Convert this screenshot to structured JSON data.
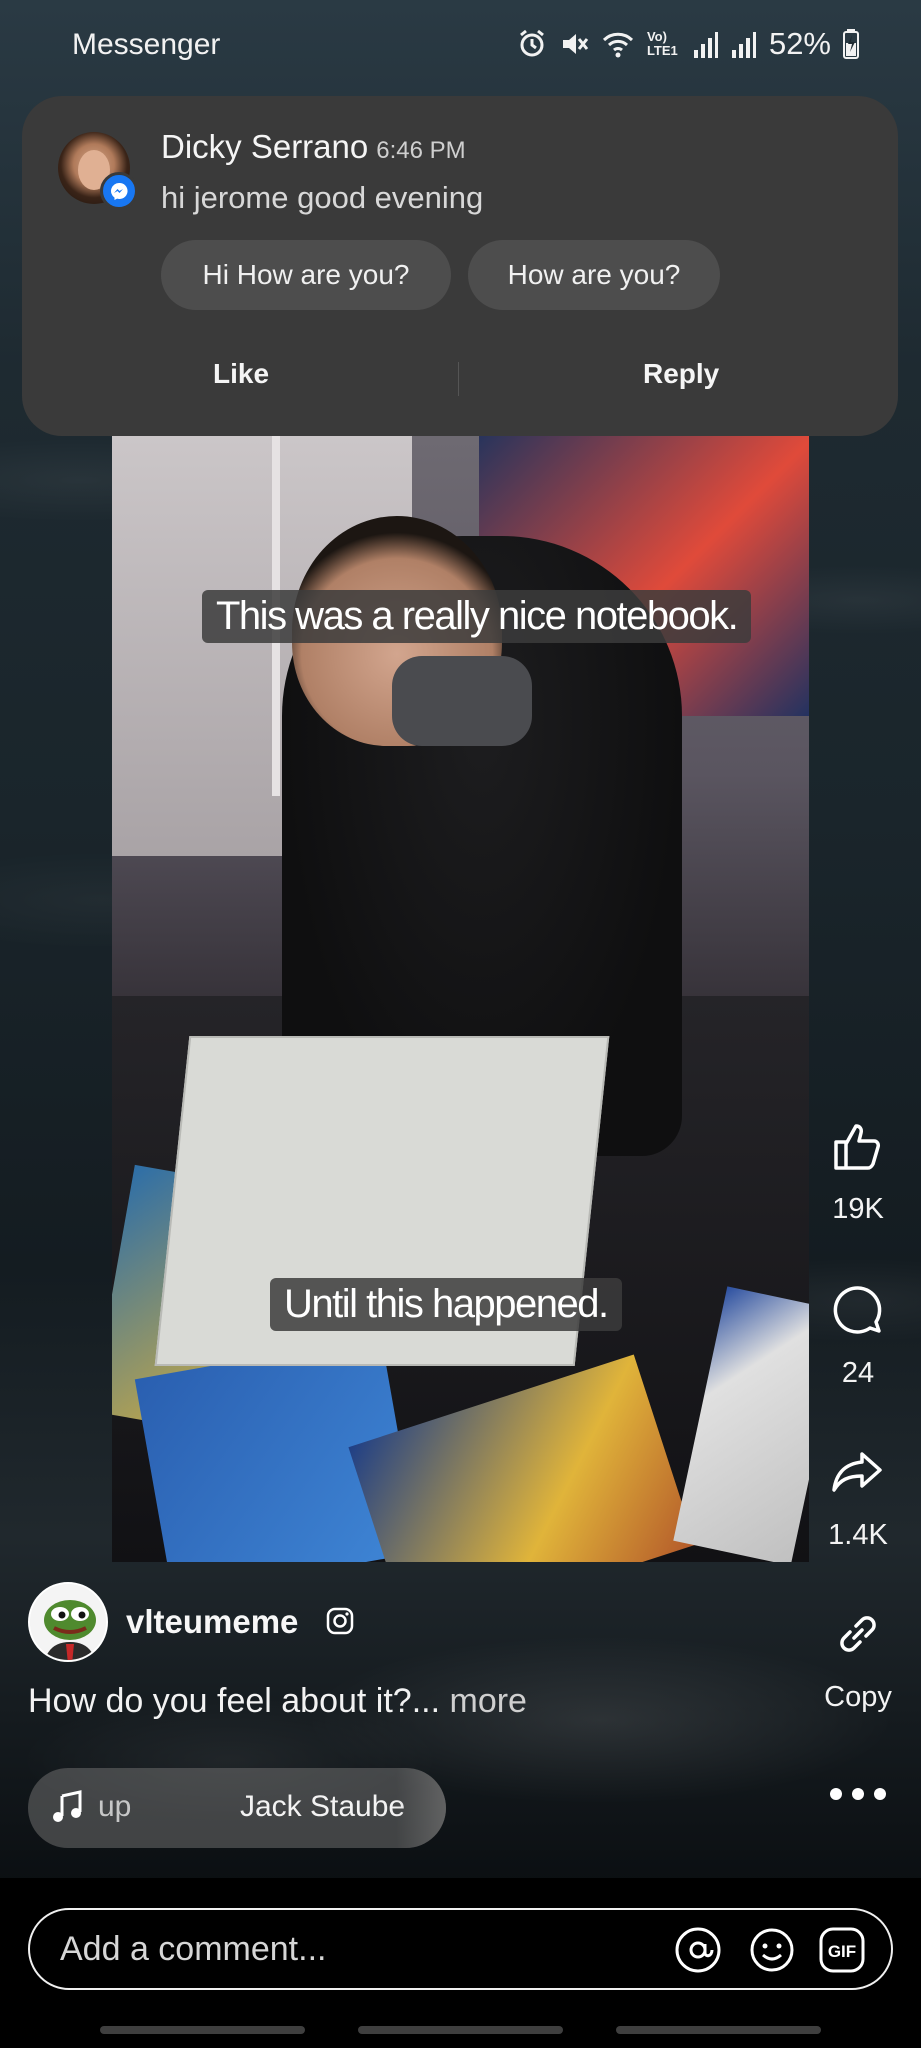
{
  "status_bar": {
    "app_name": "Messenger",
    "network_label": "Vo) LTE1",
    "battery": "52%",
    "icons": [
      "alarm-icon",
      "mute-icon",
      "wifi-icon",
      "signal-icon",
      "signal-icon",
      "battery-icon"
    ]
  },
  "notification": {
    "sender": "Dicky Serrano",
    "time": "6:46 PM",
    "message": "hi jerome good evening",
    "quick_replies": [
      "Hi How are you?",
      "How are you?"
    ],
    "actions": {
      "like": "Like",
      "reply": "Reply"
    },
    "badge_icon": "messenger-icon"
  },
  "video": {
    "captions": [
      "This was a really nice notebook.",
      "Until this happened."
    ]
  },
  "rail": {
    "like_count": "19K",
    "comment_count": "24",
    "share_count": "1.4K",
    "copy_label": "Copy",
    "icons": [
      "thumbs-up-icon",
      "comment-icon",
      "share-icon",
      "link-icon",
      "more-icon"
    ]
  },
  "post": {
    "author": "vlteumeme",
    "caption": "How do you feel about it?...",
    "more_label": "more"
  },
  "music": {
    "prev_text": "up",
    "artist": "Jack Staube"
  },
  "comment_bar": {
    "placeholder": "Add a comment...",
    "icons": [
      "mention-icon",
      "emoji-icon",
      "gif-icon"
    ],
    "gif_label": "GIF"
  }
}
